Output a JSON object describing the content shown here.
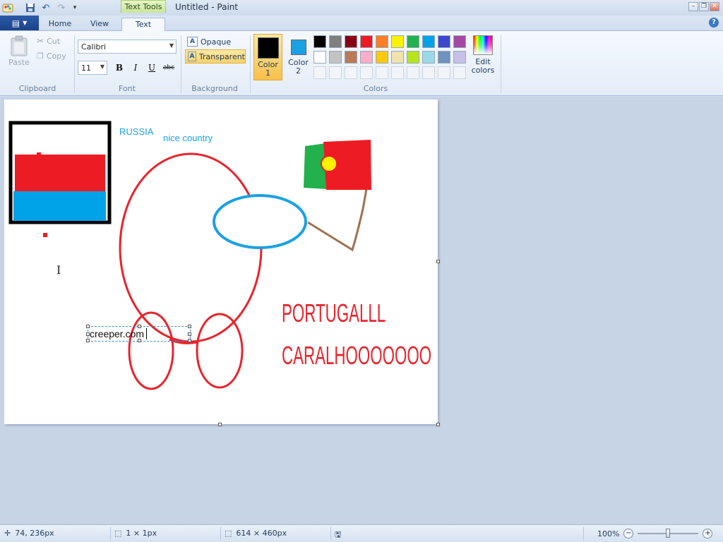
{
  "titlebar": {
    "title": "Untitled - Paint",
    "context_tab_title": "Text Tools",
    "qa_icons": [
      "paint-app-icon",
      "save-icon",
      "undo-icon",
      "redo-icon",
      "customize-icon"
    ]
  },
  "tabs": {
    "file_icon": "menu-icon",
    "items": [
      "Home",
      "View",
      "Text"
    ],
    "active": "Text",
    "help": "?"
  },
  "ribbon": {
    "clipboard": {
      "paste": "Paste",
      "cut": "Cut",
      "copy": "Copy",
      "label": "Clipboard"
    },
    "font": {
      "family": "Calibri",
      "size": "11",
      "bold": "B",
      "italic": "I",
      "underline": "U",
      "strikethrough": "abc",
      "label": "Font"
    },
    "background": {
      "opaque": "Opaque",
      "transparent": "Transparent",
      "selected": "Transparent",
      "label": "Background"
    },
    "colors": {
      "color1_label": "Color 1",
      "color1_value": "#000000",
      "color2_label": "Color 2",
      "color2_value": "#1ba1e2",
      "palette_row1": [
        "#000000",
        "#7f7f7f",
        "#880015",
        "#ed1c24",
        "#ff7f27",
        "#fff200",
        "#22b14c",
        "#00a2e8",
        "#3f48cc",
        "#a349a4"
      ],
      "palette_row2": [
        "#ffffff",
        "#c3c3c3",
        "#b97a57",
        "#ffaec9",
        "#ffc90e",
        "#efe4b0",
        "#b5e61d",
        "#99d9ea",
        "#7092be",
        "#c8bfe7"
      ],
      "edit_colors": "Edit colors",
      "label": "Colors"
    }
  },
  "canvas": {
    "texts": {
      "russia": "RUSSIA",
      "nice_country": "nice country",
      "portugal": "PORTUGALLL",
      "caralho": "CARALHOOOOOOO",
      "editing": "creeper.com"
    }
  },
  "statusbar": {
    "cursor_pos": "74, 236px",
    "selection_size": "1 × 1px",
    "image_size": "614 × 460px",
    "zoom": "100%",
    "zoom_fraction": 0.5
  }
}
